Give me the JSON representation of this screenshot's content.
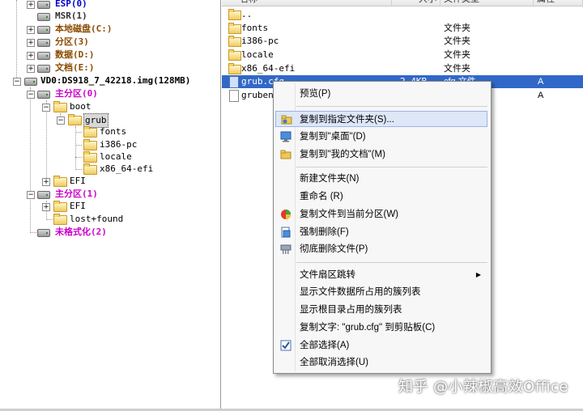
{
  "tree": {
    "items": [
      {
        "label": "ESP(0)"
      },
      {
        "label": "MSR(1)"
      },
      {
        "label": "本地磁盘(C:)"
      },
      {
        "label": "分区(3)"
      },
      {
        "label": "数据(D:)"
      },
      {
        "label": "文档(E:)"
      },
      {
        "label": "VD0:DS918_7_42218.img(128MB)"
      },
      {
        "label": "主分区(0)"
      },
      {
        "label": "boot"
      },
      {
        "label": "grub"
      },
      {
        "label": "fonts"
      },
      {
        "label": "i386-pc"
      },
      {
        "label": "locale"
      },
      {
        "label": "x86_64-efi"
      },
      {
        "label": "EFI"
      },
      {
        "label": "主分区(1)"
      },
      {
        "label": "EFI"
      },
      {
        "label": "lost+found"
      },
      {
        "label": "未格式化(2)"
      }
    ]
  },
  "filelist": {
    "headers": {
      "name": "名称",
      "size": "大小",
      "type": "文件类型",
      "attr": "属性"
    },
    "rows": [
      {
        "name": "..",
        "size": "",
        "type": "",
        "attr": ""
      },
      {
        "name": "fonts",
        "size": "",
        "type": "文件夹",
        "attr": ""
      },
      {
        "name": "i386-pc",
        "size": "",
        "type": "文件夹",
        "attr": ""
      },
      {
        "name": "locale",
        "size": "",
        "type": "文件夹",
        "attr": ""
      },
      {
        "name": "x86_64-efi",
        "size": "",
        "type": "文件夹",
        "attr": ""
      },
      {
        "name": "grub.cfg",
        "size": "2.4KB",
        "type": "cfg 文件",
        "attr": "A"
      },
      {
        "name": "grubenv",
        "size": "",
        "type": "",
        "attr": "A"
      }
    ]
  },
  "menu": {
    "items": [
      {
        "label": "预览(P)",
        "icon": "none"
      },
      {
        "label": "复制到指定文件夹(S)...",
        "icon": "copy-to-folder-icon"
      },
      {
        "label": "复制到\"桌面\"(D)",
        "icon": "desktop-icon"
      },
      {
        "label": "复制到\"我的文档\"(M)",
        "icon": "documents-folder-icon"
      },
      {
        "label": "新建文件夹(N)",
        "icon": "none"
      },
      {
        "label": "重命名 (R)",
        "icon": "none"
      },
      {
        "label": "复制文件到当前分区(W)",
        "icon": "partition-icon"
      },
      {
        "label": "强制删除(F)",
        "icon": "force-delete-icon"
      },
      {
        "label": "彻底删除文件(P)",
        "icon": "shred-icon"
      },
      {
        "label": "文件扇区跳转",
        "icon": "none"
      },
      {
        "label": "显示文件数据所占用的簇列表",
        "icon": "none"
      },
      {
        "label": "显示根目录占用的簇列表",
        "icon": "none"
      },
      {
        "label": "复制文字: \"grub.cfg\" 到剪贴板(C)",
        "icon": "none"
      },
      {
        "label": "全部选择(A)",
        "icon": "checkbox-icon"
      },
      {
        "label": "全部取消选择(U)",
        "icon": "none"
      }
    ]
  },
  "watermark": "知乎 @小辣椒高效Office",
  "colors": {
    "selection": "#3168c8",
    "menu_highlight": "#dde7f8",
    "tree_partition": "#cc00cc",
    "tree_drive": "#8a4a00"
  }
}
